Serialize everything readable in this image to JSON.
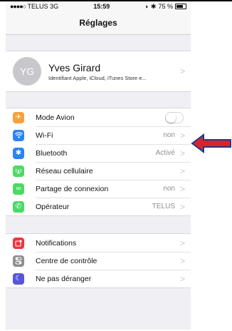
{
  "status_bar": {
    "carrier": "TELUS",
    "network": "3G",
    "time": "15:59",
    "battery": "75 %"
  },
  "nav": {
    "title": "Réglages"
  },
  "profile": {
    "initials": "YG",
    "name": "Yves Girard",
    "subtitle": "Identifiant Apple, iCloud, iTunes Store e..."
  },
  "group1": [
    {
      "label": "Mode Avion",
      "value": "",
      "icon": "airplane-icon",
      "color": "#f7a13b"
    },
    {
      "label": "Wi-Fi",
      "value": "non",
      "icon": "wifi-icon",
      "color": "#2a84f5"
    },
    {
      "label": "Bluetooth",
      "value": "Activé",
      "icon": "bluetooth-icon",
      "color": "#2a84f5"
    },
    {
      "label": "Réseau cellulaire",
      "value": "",
      "icon": "cellular-icon",
      "color": "#4cd964"
    },
    {
      "label": "Partage de connexion",
      "value": "non",
      "icon": "hotspot-icon",
      "color": "#4cd964"
    },
    {
      "label": "Opérateur",
      "value": "TELUS",
      "icon": "phone-icon",
      "color": "#4cd964"
    }
  ],
  "group2": [
    {
      "label": "Notifications",
      "icon": "notifications-icon",
      "color": "#f0333d"
    },
    {
      "label": "Centre de contrôle",
      "icon": "control-center-icon",
      "color": "#8e8e93"
    },
    {
      "label": "Ne pas déranger",
      "icon": "moon-icon",
      "color": "#5856d6"
    }
  ],
  "airplane_mode_on": false,
  "annotation_arrow_color": "#d9252a"
}
